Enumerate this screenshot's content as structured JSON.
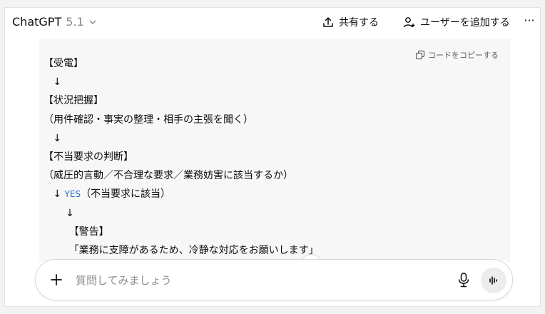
{
  "header": {
    "model_name": "ChatGPT",
    "model_version": "5.1",
    "share_label": "共有する",
    "add_user_label": "ユーザーを追加する",
    "more_label": "···"
  },
  "code_block": {
    "copy_label": "コードをコピーする",
    "lines": [
      "【受電】",
      "   ↓",
      "【状況把握】",
      "（用件確認・事実の整理・相手の主張を聞く）",
      "   ↓",
      "【不当要求の判断】",
      "（威圧的言動／不合理な要求／業務妨害に該当するか）",
      "   ↓ ",
      "       ↓",
      "        【警告】",
      "        「業務に支障があるため、冷静な対応をお願いします」",
      "       ↓"
    ],
    "yes_label": "YES",
    "yes_suffix": "（不当要求に該当）"
  },
  "composer": {
    "placeholder": "質問してみましょう"
  },
  "colors": {
    "accent_blue": "#2a6ed8",
    "text": "#0d0d0d",
    "muted": "#8f8f8f",
    "code_bg": "#f7f7f7"
  },
  "icons": {
    "share": "upload-icon",
    "add_user": "person-plus-icon",
    "copy": "copy-icon",
    "scroll_down": "arrow-down-icon",
    "mute": "speaker-off-icon",
    "mic": "microphone-icon",
    "plus": "plus-icon",
    "voice": "waveform-icon"
  }
}
